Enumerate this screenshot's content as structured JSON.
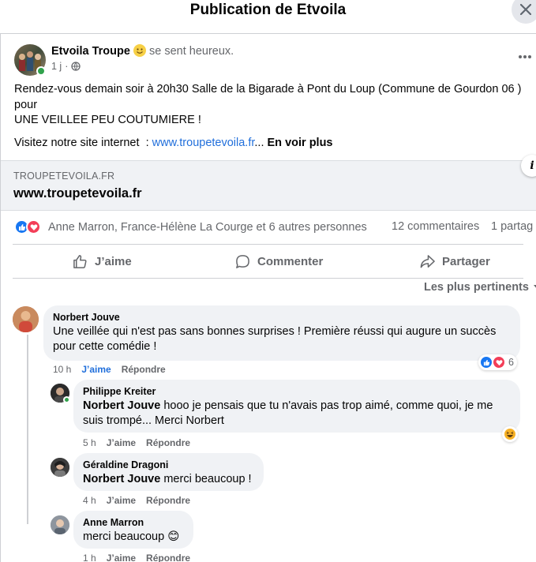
{
  "dialog": {
    "title": "Publication de Etvoila"
  },
  "post": {
    "author": "Etvoila Troupe",
    "feeling": "se sent heureux.",
    "time": "1 j",
    "separator": "·",
    "text_line1": "Rendez-vous demain soir à 20h30 Salle de la Bigarade à Pont du Loup (Commune de Gourdon 06 )",
    "text_line2": "pour",
    "text_line3": "UNE VEILLEE PEU COUTUMIERE !",
    "site_prefix": "Visitez notre site internet  : ",
    "site_link": "www.troupetevoila.fr",
    "ellipsis": "...",
    "see_more": "En voir plus",
    "link_preview": {
      "domain": "TROUPETEVOILA.FR",
      "headline": "www.troupetevoila.fr"
    }
  },
  "stats": {
    "reaction_names": "Anne Marron, France-Hélène La Courge et 6 autres personnes",
    "comments": "12 commentaires",
    "shares": "1 partag"
  },
  "actions": {
    "like": "J’aime",
    "comment": "Commenter",
    "share": "Partager"
  },
  "sort": {
    "label": "Les plus pertinents"
  },
  "comments": [
    {
      "author": "Norbert Jouve",
      "line1": "Une veillée qui n'est pas sans bonnes surprises ! Première réussi qui augure un succès",
      "line2": "pour cette comédie !",
      "time": "10 h",
      "like": "J’aime",
      "reply": "Répondre",
      "reaction_count": "6"
    },
    {
      "author": "Philippe Kreiter",
      "mention": "Norbert Jouve",
      "line1": " hooo je pensais que tu n'avais pas trop aimé, comme quoi, je me",
      "line2": "suis trompé... Merci Norbert",
      "time": "5 h",
      "like": "J’aime",
      "reply": "Répondre"
    },
    {
      "author": "Géraldine Dragoni",
      "mention": "Norbert Jouve",
      "line1": " merci beaucoup !",
      "time": "4 h",
      "like": "J’aime",
      "reply": "Répondre"
    },
    {
      "author": "Anne Marron",
      "line1": "merci beaucoup",
      "emoji": "😊",
      "time": "1 h",
      "like": "J’aime",
      "reply": "Répondre"
    }
  ],
  "colors": {
    "link": "#216fdb",
    "muted": "#65676b",
    "bubble": "#f0f2f5",
    "like_blue": "#1877f2",
    "love_red": "#f33e58"
  },
  "icons": [
    "close-icon",
    "globe-icon",
    "more-icon",
    "info-icon",
    "like-reaction-icon",
    "love-reaction-icon",
    "thumbs-up-icon",
    "comment-icon",
    "share-icon",
    "chevron-down-icon",
    "haha-reaction-icon",
    "smile-emoji-icon"
  ]
}
